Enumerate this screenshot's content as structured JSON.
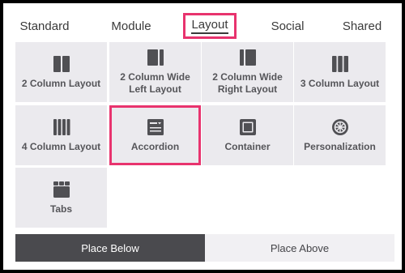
{
  "tabs": [
    {
      "label": "Standard"
    },
    {
      "label": "Module"
    },
    {
      "label": "Layout"
    },
    {
      "label": "Social"
    },
    {
      "label": "Shared"
    }
  ],
  "selected_tab": "Layout",
  "tiles": [
    {
      "label": "2 Column Layout",
      "icon": "two-column-icon"
    },
    {
      "label": "2 Column Wide Left Layout",
      "icon": "two-column-wide-left-icon"
    },
    {
      "label": "2 Column Wide Right Layout",
      "icon": "two-column-wide-right-icon"
    },
    {
      "label": "3 Column Layout",
      "icon": "three-column-icon"
    },
    {
      "label": "4 Column Layout",
      "icon": "four-column-icon"
    },
    {
      "label": "Accordion",
      "icon": "accordion-icon"
    },
    {
      "label": "Container",
      "icon": "container-icon"
    },
    {
      "label": "Personalization",
      "icon": "personalization-icon"
    },
    {
      "label": "Tabs",
      "icon": "tabs-icon"
    }
  ],
  "highlighted_tile": "Accordion",
  "actions": {
    "place_below": "Place Below",
    "place_above": "Place Above"
  },
  "colors": {
    "highlight": "#e8336e",
    "tile_background": "#ebeaee",
    "icon": "#505054",
    "active_button": "#4a4a4e",
    "inactive_button": "#f1f0f3"
  }
}
